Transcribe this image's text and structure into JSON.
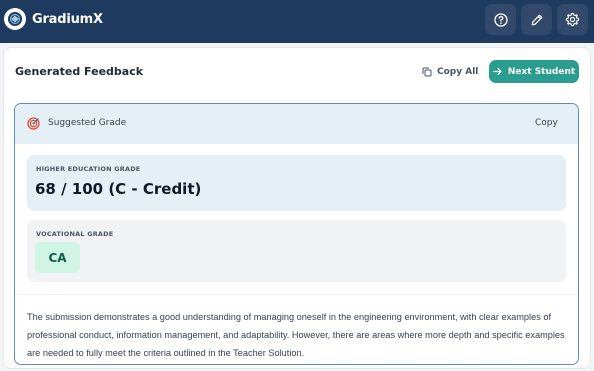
{
  "app": {
    "name": "GradiumX",
    "icons": {
      "logo": "gradiumx-logo-icon",
      "help": "help-circle-icon",
      "edit": "pencil-icon",
      "settings": "gear-icon"
    }
  },
  "feedback_card": {
    "title": "Generated Feedback",
    "copy_all_label": "Copy All",
    "next_student_label": "Next Student"
  },
  "suggested_grade": {
    "title": "Suggested Grade",
    "copy_label": "Copy",
    "higher_education": {
      "label": "HIGHER EDUCATION GRADE",
      "value": "68 / 100 (C - Credit)"
    },
    "vocational": {
      "label": "VOCATIONAL GRADE",
      "value": "CA"
    },
    "feedback_text": "The submission demonstrates a good understanding of managing oneself in the engineering environment, with clear examples of professional conduct, information management, and adaptability. However, there are areas where more depth and specific examples are needed to fully meet the criteria outlined in the Teacher Solution."
  },
  "colors": {
    "topbar": "#1e3a5f",
    "accent": "#2a9d8f",
    "panel_border": "#5b8fb9",
    "panel_header": "#e4f0f5",
    "vocational_badge": "#d1f5e4"
  }
}
